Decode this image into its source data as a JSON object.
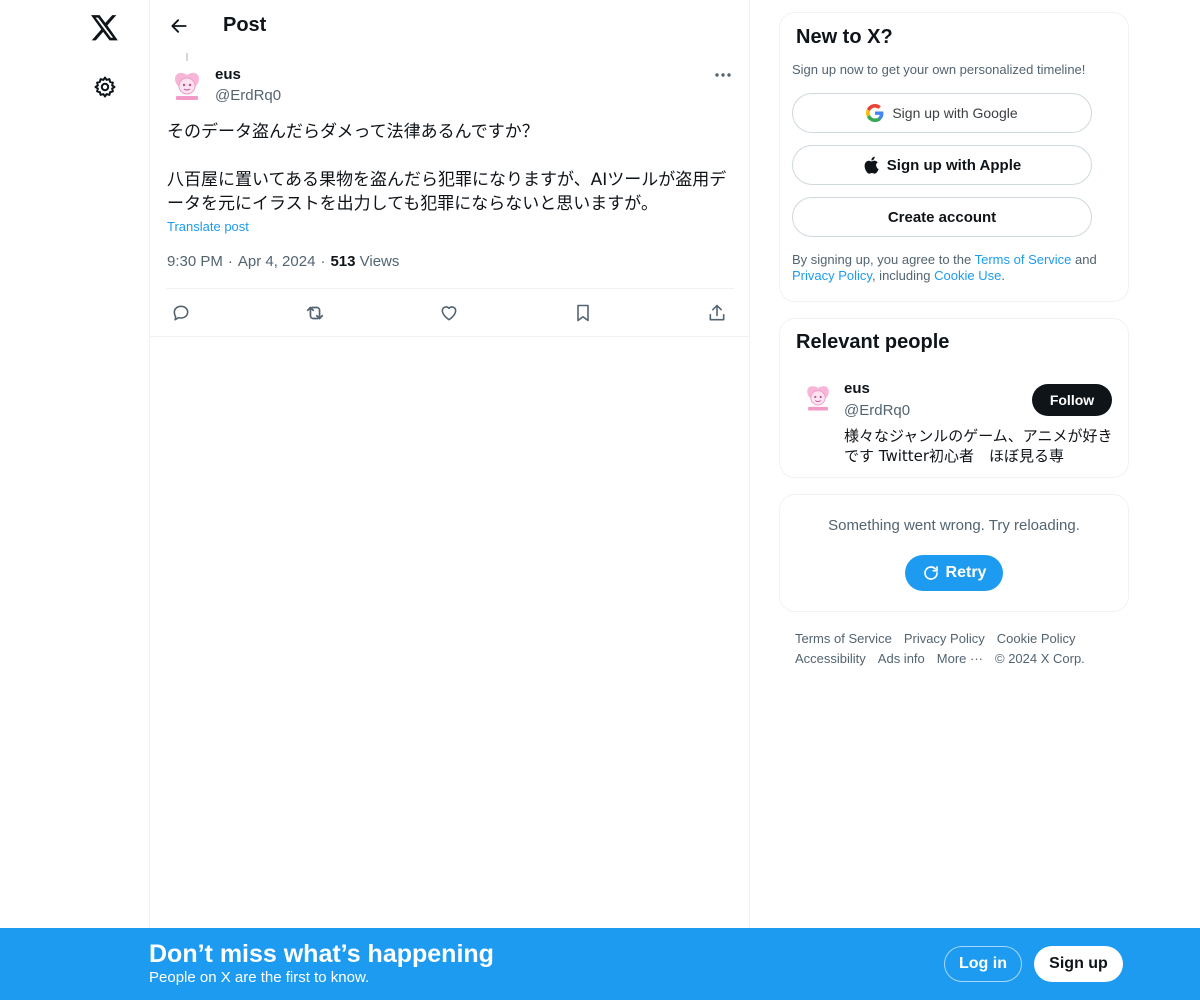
{
  "nav": {
    "logo_icon": "x-logo-icon",
    "settings_icon": "gear-icon"
  },
  "header": {
    "back_icon": "arrow-left-icon",
    "title": "Post"
  },
  "post": {
    "author_name": "eus",
    "author_handle": "@ErdRq0",
    "text_line1": "そのデータ盗んだらダメって法律あるんですか？",
    "text_line2": "八百屋に置いてある果物を盗んだら犯罪になりますが、AIツールが盗用データを元にイラストを出力しても犯罪にならないと思いますが。",
    "translate_label": "Translate post",
    "time": "9:30 PM",
    "date": "Apr 4, 2024",
    "separator": "·",
    "views_count": "513",
    "views_label": "Views",
    "actions": [
      "reply-icon",
      "repost-icon",
      "like-icon",
      "bookmark-icon",
      "share-icon"
    ]
  },
  "sidebar": {
    "newto": {
      "title": "New to X?",
      "subtitle": "Sign up now to get your own personalized timeline!",
      "google_label": "Sign up with Google",
      "apple_label": "Sign up with Apple",
      "create_label": "Create account",
      "terms_prefix": "By signing up, you agree to the ",
      "terms_link": "Terms of Service",
      "terms_and": " and ",
      "privacy_link": "Privacy Policy",
      "terms_including": ", including ",
      "cookie_link": "Cookie Use",
      "terms_end": "."
    },
    "relevant": {
      "title": "Relevant people",
      "name": "eus",
      "handle": "@ErdRq0",
      "follow_label": "Follow",
      "bio": "様々なジャンルのゲーム、アニメが好きです Twitter初心者　ほぼ見る専"
    },
    "error": {
      "message": "Something went wrong. Try reloading.",
      "retry_label": "Retry"
    },
    "footer": {
      "links": [
        "Terms of Service",
        "Privacy Policy",
        "Cookie Policy",
        "Accessibility",
        "Ads info",
        "More ···",
        "© 2024 X Corp."
      ]
    }
  },
  "banner": {
    "title": "Don’t miss what’s happening",
    "subtitle": "People on X are the first to know.",
    "login_label": "Log in",
    "signup_label": "Sign up"
  },
  "colors": {
    "accent": "#1d9bf0",
    "text": "#0f1419",
    "secondary_text": "#536471",
    "border": "#eff3f4"
  }
}
